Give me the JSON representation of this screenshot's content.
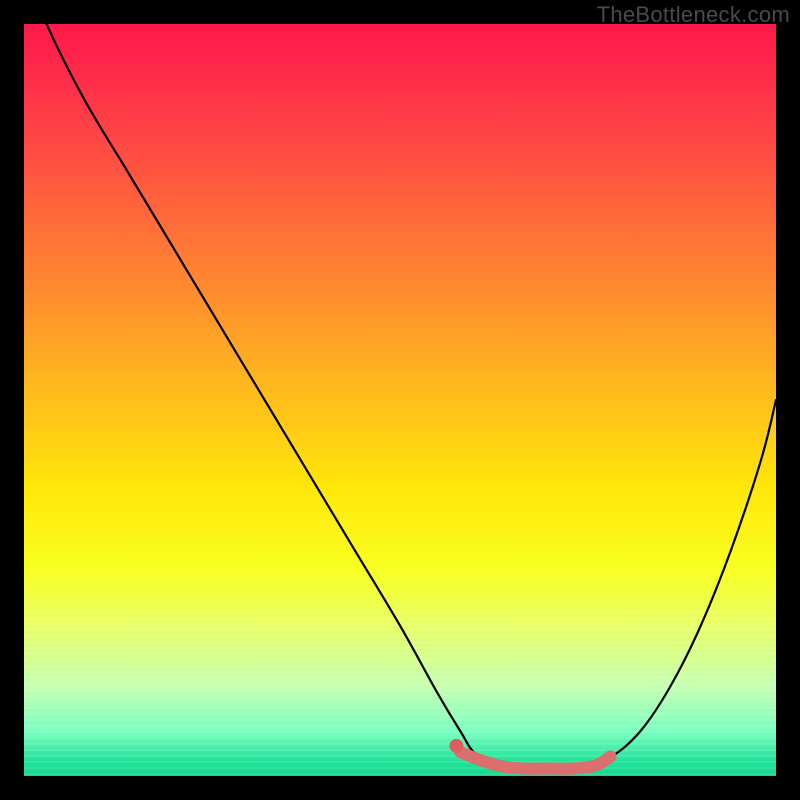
{
  "watermark": "TheBottleneck.com",
  "colors": {
    "frame": "#000000",
    "curve": "#000000",
    "highlight": "#dd6e6e",
    "dot": "#de5d5d",
    "gradient_top": "#ff1a4b",
    "gradient_bottom": "#14d68c"
  },
  "chart_data": {
    "type": "line",
    "title": "",
    "xlabel": "",
    "ylabel": "",
    "xlim": [
      0,
      100
    ],
    "ylim": [
      0,
      100
    ],
    "grid": false,
    "legend": false,
    "series": [
      {
        "name": "bottleneck-curve",
        "x": [
          0,
          3,
          8,
          14,
          20,
          26,
          32,
          38,
          44,
          50,
          55,
          58,
          60,
          63,
          66,
          70,
          74,
          78,
          82,
          86,
          90,
          94,
          98,
          100
        ],
        "values": [
          108,
          100,
          90,
          80,
          70,
          60,
          50,
          40,
          30,
          20,
          11,
          6,
          3,
          1.5,
          1,
          1,
          1,
          2.5,
          6,
          12,
          20,
          30,
          42,
          50
        ]
      }
    ],
    "highlight": {
      "name": "optimal-range",
      "x": [
        58,
        61,
        64,
        67,
        70,
        73,
        76,
        78
      ],
      "values": [
        3.2,
        2.0,
        1.2,
        1.0,
        1.0,
        1.0,
        1.4,
        2.6
      ]
    },
    "marker": {
      "x": 57.5,
      "value": 4.0
    }
  }
}
